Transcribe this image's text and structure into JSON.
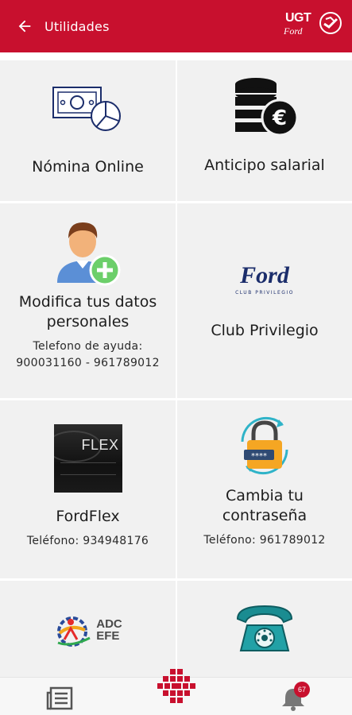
{
  "header": {
    "title": "Utilidades",
    "back_icon": "arrow-left-icon",
    "brand": {
      "ugt": "UGT",
      "ford": "Ford"
    }
  },
  "tiles": {
    "nomina": {
      "title": "Nómina Online",
      "icon": "payslip-chart-icon"
    },
    "anticipo": {
      "title": "Anticipo salarial",
      "icon": "coins-euro-icon"
    },
    "datos": {
      "title_line1": "Modifica tus datos",
      "title_line2": "personales",
      "help_line1": "Telefono de ayuda:",
      "help_line2": "900031160 - 961789012",
      "icon": "user-add-icon"
    },
    "club": {
      "title": "Club Privilegio",
      "logo_word": "Ford",
      "logo_sub": "CLUB PRIVILEGIO",
      "icon": "ford-club-logo"
    },
    "fordflex": {
      "title": "FordFlex",
      "phone": "Teléfono: 934948176",
      "logo_text": "FLEX",
      "icon": "fordflex-logo"
    },
    "password": {
      "title_line1": "Cambia tu",
      "title_line2": "contraseña",
      "phone": "Teléfono: 961789012",
      "icon": "padlock-icon"
    },
    "adc": {
      "logo_line1": "ADC",
      "logo_line2": "EFE",
      "icon": "adc-efe-logo"
    },
    "phone": {
      "icon": "vintage-telephone-icon"
    }
  },
  "bottom_nav": {
    "news_icon": "news-icon",
    "home_icon": "ugt-grid-logo-icon",
    "bell_icon": "bell-icon",
    "badge_count": "67"
  },
  "colors": {
    "brand_red": "#c8102e",
    "tile_bg": "#f1f1f1",
    "ford_blue": "#1b2d6b",
    "lock_orange": "#f5a623",
    "cyan": "#2fb3c8"
  }
}
